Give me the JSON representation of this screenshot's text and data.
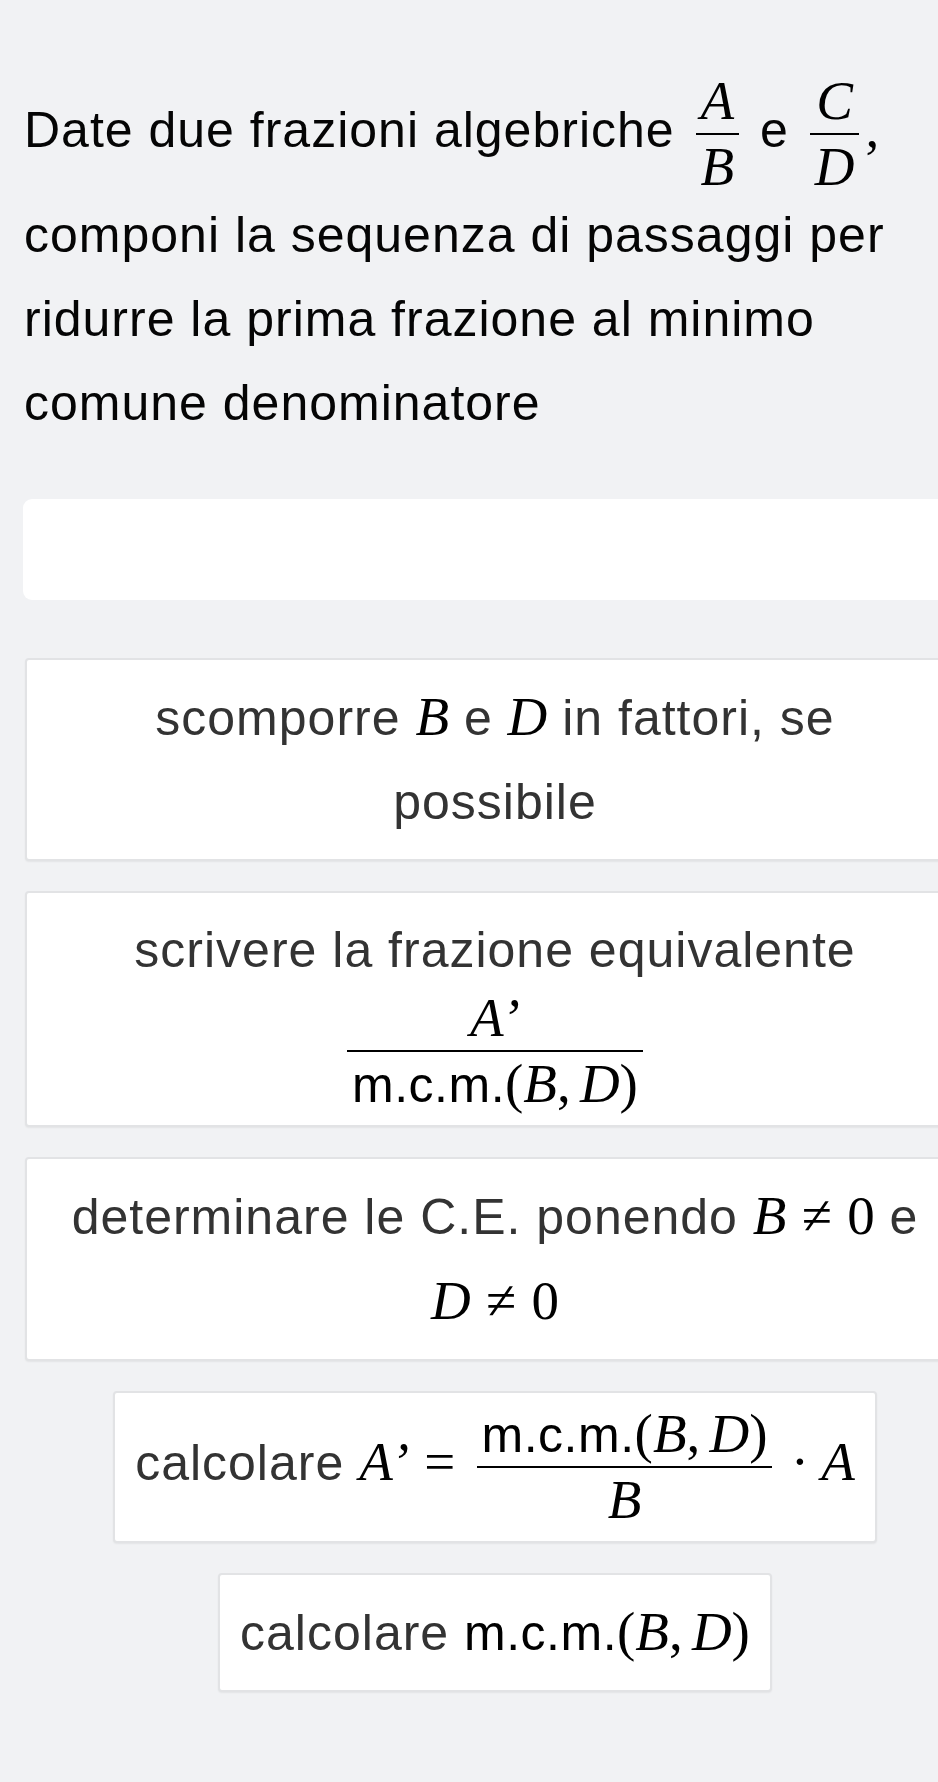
{
  "question": {
    "parts": [
      {
        "kind": "text",
        "text": "Date due frazioni algebriche "
      },
      {
        "kind": "fraction",
        "numerator": [
          {
            "kind": "var",
            "text": "A"
          }
        ],
        "denominator": [
          {
            "kind": "var",
            "text": "B"
          }
        ]
      },
      {
        "kind": "text",
        "text": " e "
      },
      {
        "kind": "fraction",
        "numerator": [
          {
            "kind": "var",
            "text": "C"
          }
        ],
        "denominator": [
          {
            "kind": "var",
            "text": "D"
          }
        ]
      },
      {
        "kind": "punct",
        "text": ","
      },
      {
        "kind": "text",
        "text": " componi la sequenza di passaggi per ridurre la prima frazione al minimo comune denominatore"
      }
    ]
  },
  "steps": [
    {
      "parts": [
        {
          "kind": "text",
          "text": "scomporre "
        },
        {
          "kind": "var",
          "text": "B"
        },
        {
          "kind": "text",
          "text": " e "
        },
        {
          "kind": "var",
          "text": "D"
        },
        {
          "kind": "text",
          "text": " in fattori, se possibile"
        }
      ]
    },
    {
      "parts": [
        {
          "kind": "text",
          "text": "scrivere la frazione equivalente "
        },
        {
          "kind": "fraction",
          "numerator": [
            {
              "kind": "var",
              "text": "A’"
            }
          ],
          "denominator": [
            {
              "kind": "name",
              "text": "m.c.m."
            },
            {
              "kind": "sym",
              "text": "("
            },
            {
              "kind": "var",
              "text": "B"
            },
            {
              "kind": "punct",
              "text": ","
            },
            {
              "kind": "var",
              "text": "D"
            },
            {
              "kind": "sym",
              "text": ")"
            }
          ]
        }
      ]
    },
    {
      "parts": [
        {
          "kind": "text",
          "text": "determinare le C.E. ponendo "
        },
        {
          "kind": "var",
          "text": "B"
        },
        {
          "kind": "rel",
          "text": "≠"
        },
        {
          "kind": "sym",
          "text": "0"
        },
        {
          "kind": "text",
          "text": " e "
        },
        {
          "kind": "var",
          "text": "D"
        },
        {
          "kind": "rel",
          "text": "≠"
        },
        {
          "kind": "sym",
          "text": "0"
        }
      ]
    },
    {
      "parts": [
        {
          "kind": "text",
          "text": "calcolare "
        },
        {
          "kind": "var",
          "text": "A’"
        },
        {
          "kind": "rel",
          "text": "="
        },
        {
          "kind": "fraction",
          "numerator": [
            {
              "kind": "name",
              "text": "m.c.m."
            },
            {
              "kind": "sym",
              "text": "("
            },
            {
              "kind": "var",
              "text": "B"
            },
            {
              "kind": "punct",
              "text": ","
            },
            {
              "kind": "var",
              "text": "D"
            },
            {
              "kind": "sym",
              "text": ")"
            }
          ],
          "denominator": [
            {
              "kind": "var",
              "text": "B"
            }
          ]
        },
        {
          "kind": "bin",
          "text": "·"
        },
        {
          "kind": "var",
          "text": "A"
        }
      ]
    },
    {
      "parts": [
        {
          "kind": "text",
          "text": "calcolare "
        },
        {
          "kind": "name",
          "text": "m.c.m."
        },
        {
          "kind": "sym",
          "text": "("
        },
        {
          "kind": "var",
          "text": "B"
        },
        {
          "kind": "punct",
          "text": ","
        },
        {
          "kind": "var",
          "text": "D"
        },
        {
          "kind": "sym",
          "text": ")"
        }
      ]
    }
  ]
}
